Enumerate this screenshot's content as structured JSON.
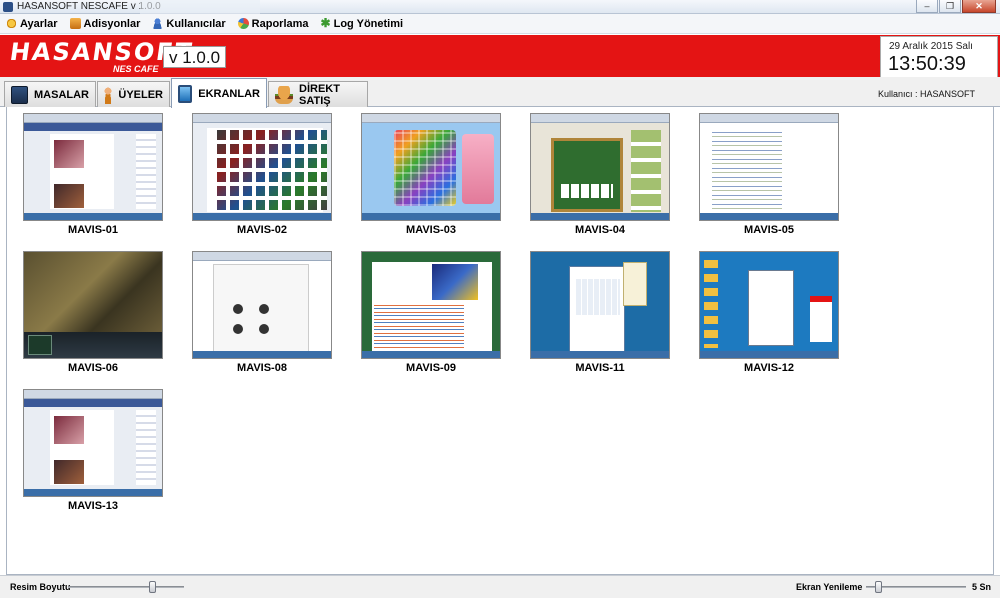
{
  "window": {
    "title": "HASANSOFT NESCAFE v 1.0.0"
  },
  "menu": [
    {
      "label": "Ayarlar",
      "icon": "gear-icon"
    },
    {
      "label": "Adisyonlar",
      "icon": "cash-icon"
    },
    {
      "label": "Kullanıcılar",
      "icon": "user-icon"
    },
    {
      "label": "Raporlama",
      "icon": "chart-icon"
    },
    {
      "label": "Log Yönetimi",
      "icon": "log-icon"
    }
  ],
  "header": {
    "brand": "HASANSOFT",
    "brand_sub": "NES CAFE",
    "version": "v 1.0.0",
    "date": "29 Aralık 2015 Salı",
    "time": "13:50:39",
    "accent_color": "#e41414"
  },
  "tabs": [
    {
      "label": "MASALAR",
      "icon": "tables-icon",
      "active": false
    },
    {
      "label": "ÜYELER",
      "icon": "members-icon",
      "active": false
    },
    {
      "label": "EKRANLAR",
      "icon": "screens-icon",
      "active": true
    },
    {
      "label": "DİREKT SATIŞ",
      "icon": "burger-icon",
      "active": false
    }
  ],
  "user_label": "Kullanıcı : HASANSOFT",
  "screens": [
    {
      "label": "MAVIS-01"
    },
    {
      "label": "MAVIS-02"
    },
    {
      "label": "MAVIS-03"
    },
    {
      "label": "MAVIS-04"
    },
    {
      "label": "MAVIS-05"
    },
    {
      "label": "MAVIS-06"
    },
    {
      "label": "MAVIS-08"
    },
    {
      "label": "MAVIS-09"
    },
    {
      "label": "MAVIS-11"
    },
    {
      "label": "MAVIS-12"
    },
    {
      "label": "MAVIS-13"
    }
  ],
  "status": {
    "image_size_label": "Resim Boyutu",
    "image_size_level": 0.75,
    "refresh_label": "Ekran Yenileme",
    "refresh_level": 0.1,
    "refresh_value": "5 Sn"
  }
}
